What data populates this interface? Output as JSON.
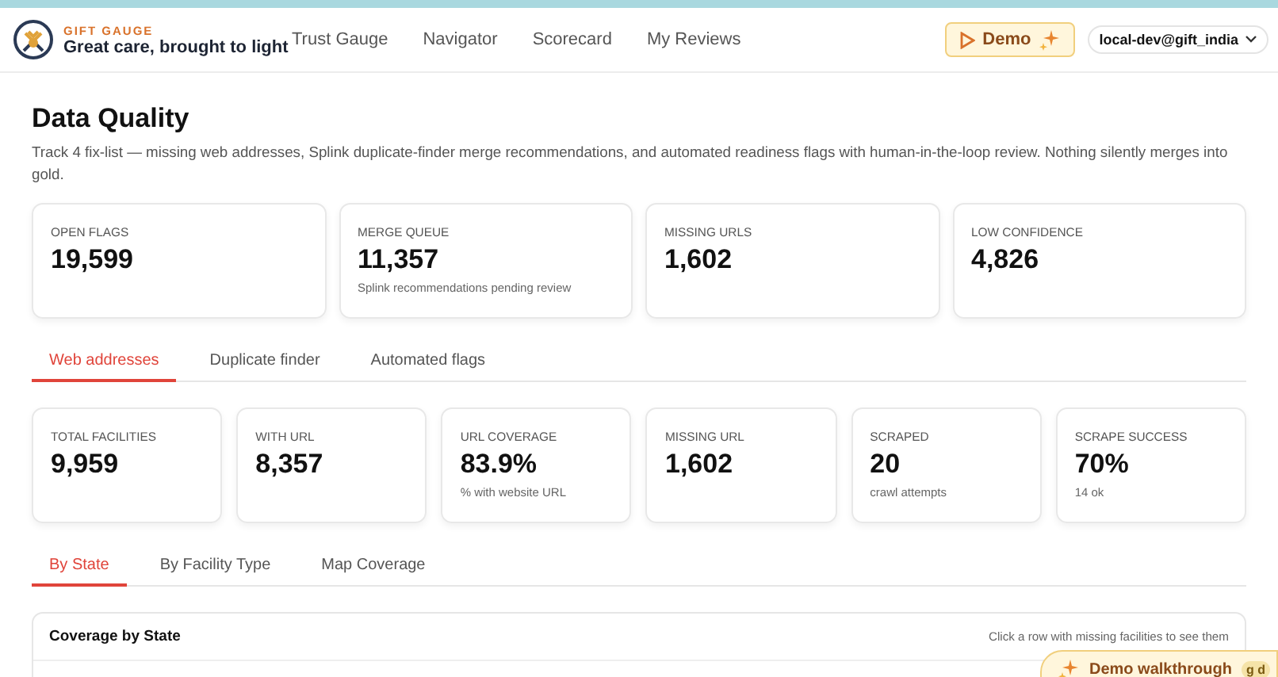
{
  "brand": {
    "name": "GIFT GAUGE",
    "tagline": "Great care, brought to light"
  },
  "nav": [
    {
      "label": "Trust Gauge",
      "selected": false
    },
    {
      "label": "Navigator",
      "selected": false
    },
    {
      "label": "Scorecard",
      "selected": false
    },
    {
      "label": "My Reviews",
      "selected": false
    }
  ],
  "demo_button": {
    "label": "Demo"
  },
  "user_menu": {
    "label": "local-dev@gift_india"
  },
  "page": {
    "title": "Data Quality",
    "description": "Track 4 fix-list — missing web addresses, Splink duplicate-finder merge recommendations, and automated readiness flags with human-in-the-loop review. Nothing silently merges into gold."
  },
  "summary_cards": [
    {
      "label": "OPEN FLAGS",
      "value": "19,599"
    },
    {
      "label": "MERGE QUEUE",
      "value": "11,357",
      "note": "Splink recommendations pending review"
    },
    {
      "label": "MISSING URLS",
      "value": "1,602"
    },
    {
      "label": "LOW CONFIDENCE",
      "value": "4,826"
    }
  ],
  "tabs": [
    {
      "label": "Web addresses",
      "selected": true
    },
    {
      "label": "Duplicate finder",
      "selected": false
    },
    {
      "label": "Automated flags",
      "selected": false
    }
  ],
  "stat_cards": [
    {
      "label": "TOTAL FACILITIES",
      "value": "9,959"
    },
    {
      "label": "WITH URL",
      "value": "8,357"
    },
    {
      "label": "URL COVERAGE",
      "value": "83.9%",
      "note": "% with website URL"
    },
    {
      "label": "MISSING URL",
      "value": "1,602"
    },
    {
      "label": "SCRAPED",
      "value": "20",
      "note": "crawl attempts"
    },
    {
      "label": "SCRAPE SUCCESS",
      "value": "70%",
      "note": "14 ok"
    }
  ],
  "sub_tabs": [
    {
      "label": "By State",
      "selected": true
    },
    {
      "label": "By Facility Type",
      "selected": false
    },
    {
      "label": "Map Coverage",
      "selected": false
    }
  ],
  "panel": {
    "title": "Coverage by State",
    "hint": "Click a row with missing facilities to see them"
  },
  "walkthrough_button": {
    "label": "Demo walkthrough",
    "shortcut": "g d"
  }
}
